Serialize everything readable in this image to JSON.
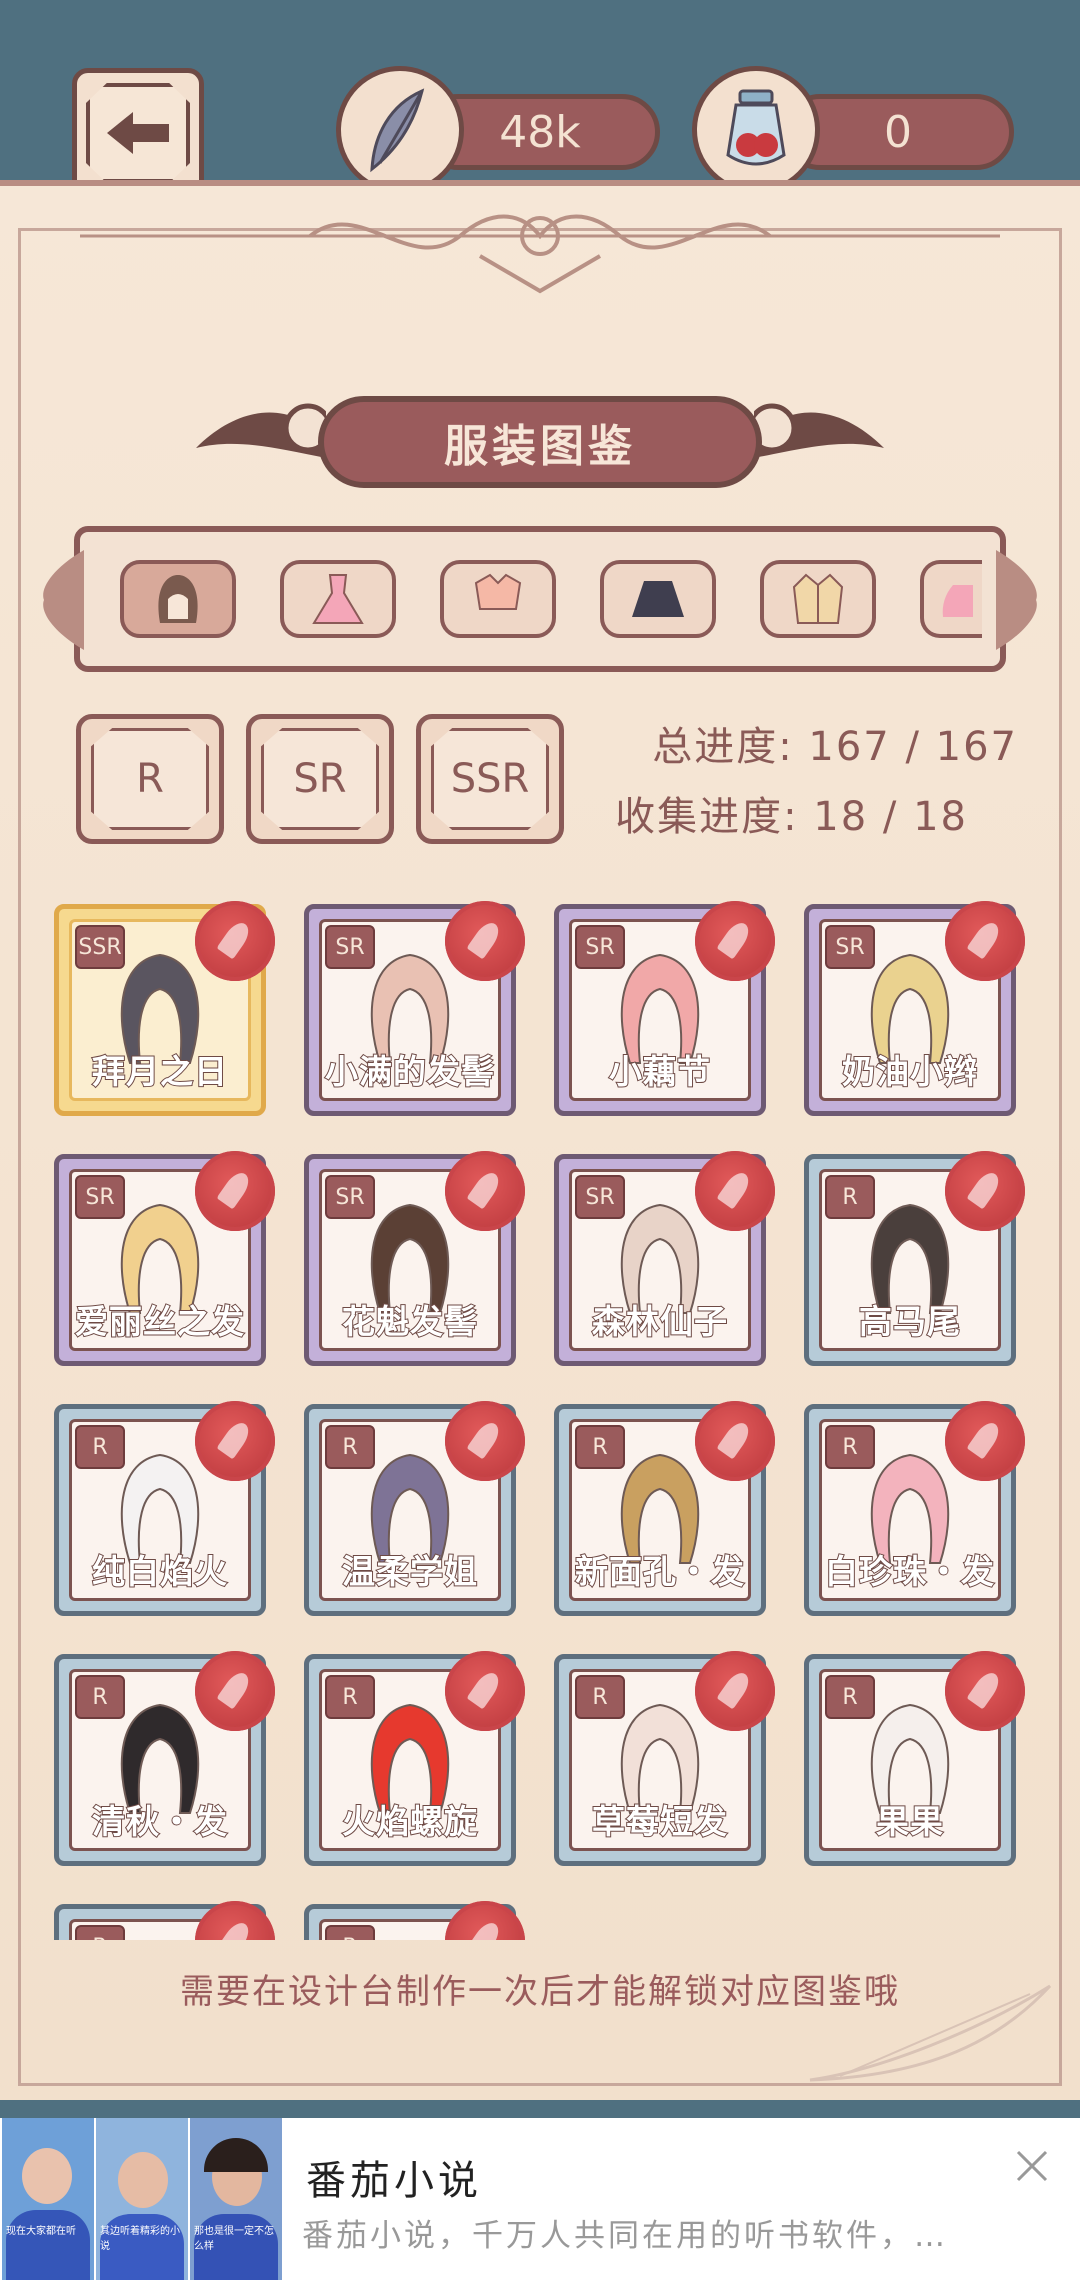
{
  "topbar": {
    "feather_value": "48k",
    "potion_value": "0"
  },
  "title": "服装图鉴",
  "tabs": [
    {
      "icon": "hair-icon",
      "active": true
    },
    {
      "icon": "dress-icon",
      "active": false
    },
    {
      "icon": "top-icon",
      "active": false
    },
    {
      "icon": "skirt-icon",
      "active": false
    },
    {
      "icon": "jacket-icon",
      "active": false
    },
    {
      "icon": "shoe-icon",
      "active": false
    }
  ],
  "rarity_filters": [
    "R",
    "SR",
    "SSR"
  ],
  "progress": {
    "total": "总进度: 167 / 167",
    "collect": "收集进度: 18 / 18"
  },
  "items": [
    {
      "rarity": "SSR",
      "name": "拜月之日",
      "hair_color": "#5a5560"
    },
    {
      "rarity": "SR",
      "name": "小满的发髻",
      "hair_color": "#e9c1b3"
    },
    {
      "rarity": "SR",
      "name": "小藕节",
      "hair_color": "#f1a8a8"
    },
    {
      "rarity": "SR",
      "name": "奶油小辫",
      "hair_color": "#ead28f"
    },
    {
      "rarity": "SR",
      "name": "爱丽丝之发",
      "hair_color": "#f1d08e"
    },
    {
      "rarity": "SR",
      "name": "花魁发髻",
      "hair_color": "#5b4035"
    },
    {
      "rarity": "SR",
      "name": "森林仙子",
      "hair_color": "#e8d3c8"
    },
    {
      "rarity": "R",
      "name": "高马尾",
      "hair_color": "#4a3f3c"
    },
    {
      "rarity": "R",
      "name": "纯白焰火",
      "hair_color": "#f4f2f2"
    },
    {
      "rarity": "R",
      "name": "温柔学姐",
      "hair_color": "#7e7396"
    },
    {
      "rarity": "R",
      "name": "新面孔・发",
      "hair_color": "#c9a060"
    },
    {
      "rarity": "R",
      "name": "白珍珠・发",
      "hair_color": "#f3b3bd"
    },
    {
      "rarity": "R",
      "name": "清秋・发",
      "hair_color": "#2f2a2c"
    },
    {
      "rarity": "R",
      "name": "火焰螺旋",
      "hair_color": "#e6392e"
    },
    {
      "rarity": "R",
      "name": "草莓短发",
      "hair_color": "#f2e0d8"
    },
    {
      "rarity": "R",
      "name": "果果",
      "hair_color": "#f5efec"
    },
    {
      "rarity": "R",
      "name": "",
      "hair_color": "#d8c0b0"
    },
    {
      "rarity": "R",
      "name": "",
      "hair_color": "#d8c0b0"
    }
  ],
  "hint": "需要在设计台制作一次后才能解锁对应图鉴哦",
  "ad": {
    "title": "番茄小说",
    "description": "番茄小说，千万人共同在用的听书软件，…",
    "thumb_captions": [
      "现在大家都在听",
      "其边听着精彩的小说",
      "那也是很一定不怎么样"
    ]
  },
  "colors": {
    "background": "#4f7080",
    "panel": "#f6e7d7",
    "accent": "#9a5b5c",
    "border": "#6e4a45"
  }
}
